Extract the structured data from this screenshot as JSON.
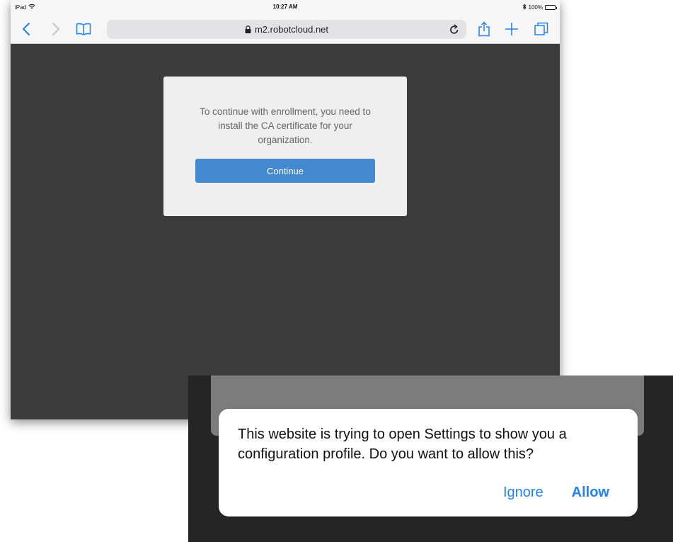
{
  "status_bar": {
    "device": "iPad",
    "time": "10:27 AM",
    "battery": "100%"
  },
  "toolbar": {
    "url": "m2.robotcloud.net",
    "icons": {
      "back": "chevron-left-icon",
      "forward": "chevron-right-icon",
      "bookmarks": "book-icon",
      "lock": "lock-icon",
      "reload": "reload-icon",
      "share": "share-icon",
      "new_tab": "plus-icon",
      "tabs": "tabs-icon"
    }
  },
  "card": {
    "message": "To continue with enrollment, you need to install the CA certificate for your organization.",
    "button_label": "Continue"
  },
  "alert": {
    "message": "This website is trying to open Settings to show you a configuration profile. Do you want to allow this?",
    "ignore_label": "Ignore",
    "allow_label": "Allow"
  },
  "colors": {
    "accent": "#1f83f5",
    "button": "#4389d0",
    "page_background": "#3b3b3b",
    "card_background": "#efeff0"
  }
}
